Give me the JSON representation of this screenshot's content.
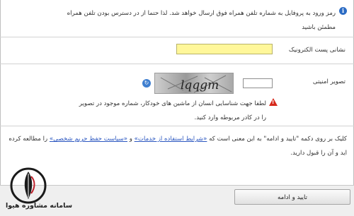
{
  "notice": {
    "icon": "info-icon",
    "text": "رمز ورود به پروفایل به شماره تلفن همراه فوق ارسال خواهد شد. لذا حتما از در دسترس بودن تلفن همراه مطمئن باشید"
  },
  "email": {
    "label": "نشانی پست الکترونیک",
    "value": ""
  },
  "captcha": {
    "label": "تصویر امنیتی",
    "value": "",
    "image_text": "lqqgm",
    "refresh_icon": "refresh-icon"
  },
  "warning": {
    "icon": "warning-icon",
    "text": "لطفا جهت شناسایی انسان از ماشین های خودکار، شماره موجود در تصویر را در کادر مربوطه وارد کنید."
  },
  "terms": {
    "before": "کلیک بر روی دکمه \"تایید و ادامه\" به این معنی است که ",
    "link1": "«شرایط استفاده از خدمات»",
    "middle": " و ",
    "link2": "«سیاست حفظ حریم شخصی»",
    "after": " را مطالعه کرده اید و آن را قبول دارید."
  },
  "submit_label": "تایید و ادامه",
  "logo": {
    "text": "سامانه مشاوره هیوا",
    "colors": {
      "ring": "#1a1a1a",
      "accent": "#c0202b"
    }
  },
  "colors": {
    "email_field_bg": "#fff79a",
    "link": "#2a56c0",
    "warning": "#d62a1c"
  }
}
